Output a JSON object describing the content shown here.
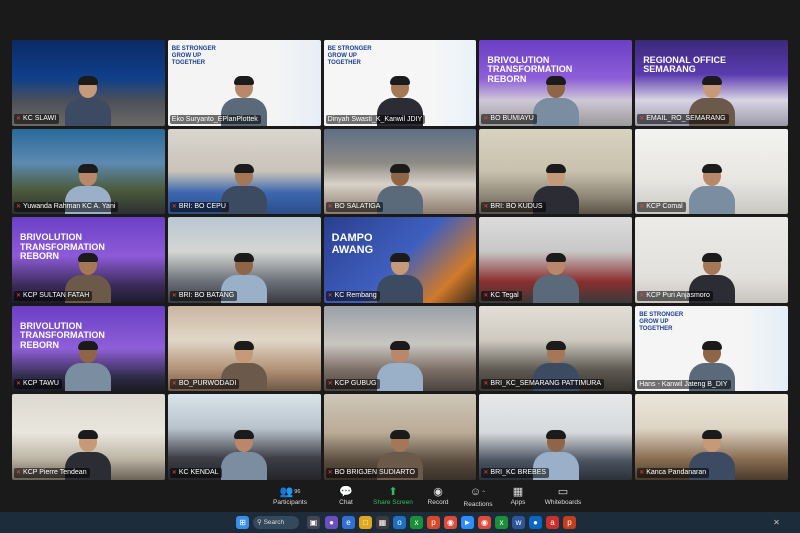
{
  "participants": [
    {
      "name": "KC SLAWI",
      "mic": true
    },
    {
      "name": "Eko Suryanto_EPlanPlottek",
      "mic": false,
      "poster": [
        "BE STRONGER",
        "GROW UP",
        "TOGETHER"
      ]
    },
    {
      "name": "Dinyah Swasti_K_Kanwil JDIY",
      "mic": false,
      "poster": [
        "BE STRONGER",
        "GROW UP",
        "TOGETHER"
      ],
      "active": true
    },
    {
      "name": "BO BUMIAYU",
      "mic": true,
      "poster": [
        "BRIVOLUTION",
        "TRANSFORMATION",
        "REBORN"
      ]
    },
    {
      "name": "EMAIL_RO_SEMARANG",
      "mic": true,
      "poster": [
        "REGIONAL OFFICE",
        "SEMARANG"
      ]
    },
    {
      "name": "Yuwanda Rahman KC A. Yani",
      "mic": true
    },
    {
      "name": "BRI: BO CEPU",
      "mic": true
    },
    {
      "name": "BO SALATIGA",
      "mic": true
    },
    {
      "name": "BRI: BO KUDUS",
      "mic": true
    },
    {
      "name": "KCP Comal",
      "mic": true
    },
    {
      "name": "KCP SULTAN FATAH",
      "mic": true,
      "poster": [
        "BRIVOLUTION",
        "TRANSFORMATION",
        "REBORN"
      ]
    },
    {
      "name": "BRI: BO BATANG",
      "mic": true
    },
    {
      "name": "KC Rembang",
      "mic": true,
      "poster": [
        "DAMPO",
        "AWANG"
      ]
    },
    {
      "name": "KC Tegal",
      "mic": true
    },
    {
      "name": "KCP Puri Anjasmoro",
      "mic": true
    },
    {
      "name": "KCP TAWU",
      "mic": true,
      "poster": [
        "BRIVOLUTION",
        "TRANSFORMATION",
        "REBORN"
      ]
    },
    {
      "name": "BO_PURWODADI",
      "mic": true
    },
    {
      "name": "KCP GUBUG",
      "mic": true
    },
    {
      "name": "BRI_KC_SEMARANG PATTIMURA",
      "mic": true
    },
    {
      "name": "Hans - Kanwil Jateng B_DIY",
      "mic": false,
      "poster": [
        "BE STRONGER",
        "GROW UP",
        "TOGETHER"
      ]
    },
    {
      "name": "KCP Pierre Tendean",
      "mic": true
    },
    {
      "name": "KC KENDAL",
      "mic": true
    },
    {
      "name": "BO BRIGJEN SUDIARTO",
      "mic": true
    },
    {
      "name": "BRI_KC BREBES",
      "mic": true
    },
    {
      "name": "Kanca Pandanaran",
      "mic": true
    }
  ],
  "toolbar": {
    "participants_label": "Participants",
    "participants_count": "96",
    "chat_label": "Chat",
    "share_label": "Share Screen",
    "record_label": "Record",
    "reactions_label": "Reactions",
    "apps_label": "Apps",
    "whiteboards_label": "Whiteboards"
  },
  "taskbar": {
    "search_label": "Search"
  },
  "colors": {
    "share_green": "#2dbd5c",
    "active_speaker": "#d6d641",
    "mic_muted": "#e44444",
    "taskbar_bg": "#1d2c3a"
  }
}
